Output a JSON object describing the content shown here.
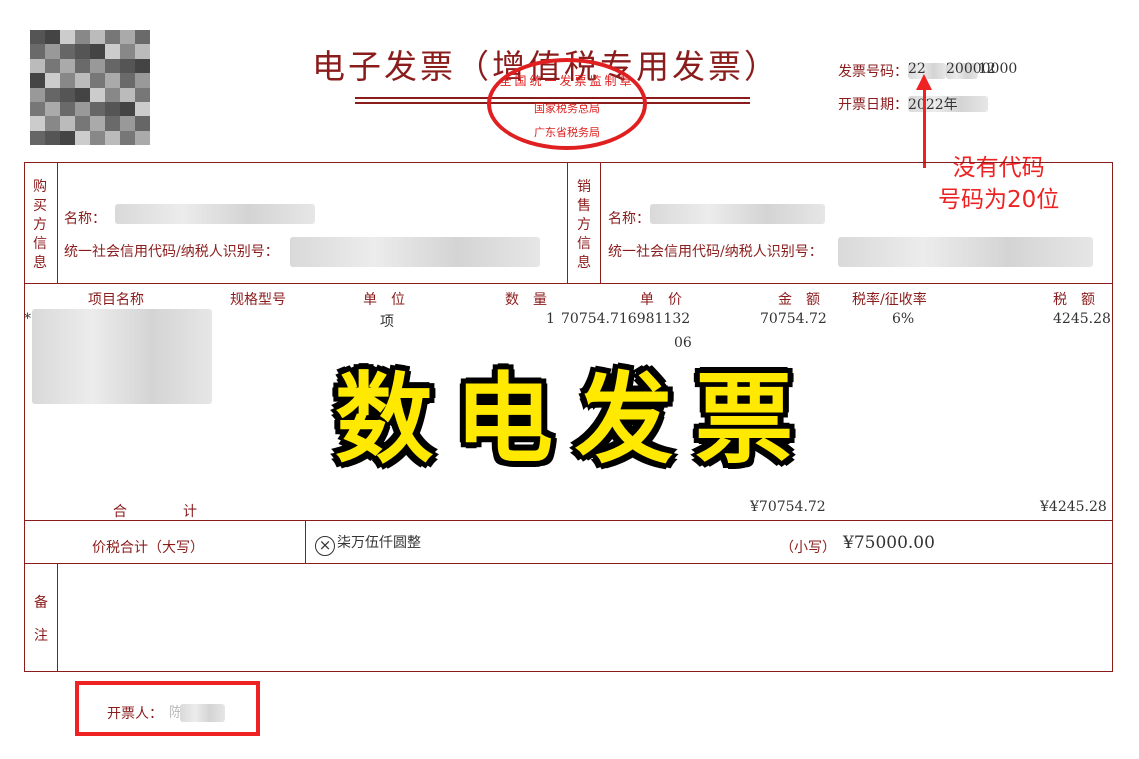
{
  "header": {
    "title": "电子发票（增值税专用发票）",
    "invoice_number_label": "发票号码：",
    "invoice_number_value": "22",
    "invoice_number_suffix": "20000000",
    "invoice_number_end": "12",
    "issue_date_label": "开票日期：",
    "issue_date_value": "2022年"
  },
  "seal": {
    "top": "全国统一发票监制章",
    "middle": "国家税务总局",
    "bottom": "广东省税务局"
  },
  "annotation": {
    "line1": "没有代码",
    "line2": "号码为20位"
  },
  "buyer": {
    "side_label": [
      "购",
      "买",
      "方",
      "信",
      "息"
    ],
    "name_label": "名称：",
    "tax_id_label": "统一社会信用代码/纳税人识别号："
  },
  "seller": {
    "side_label": [
      "销",
      "售",
      "方",
      "信",
      "息"
    ],
    "name_label": "名称：",
    "tax_id_label": "统一社会信用代码/纳税人识别号："
  },
  "items_table": {
    "headers": {
      "item_name": "项目名称",
      "spec": "规格型号",
      "unit": "单　位",
      "quantity": "数　量",
      "unit_price": "单　价",
      "amount": "金　额",
      "tax_rate": "税率/征收率",
      "tax": "税　额"
    },
    "row": {
      "name_prefix": "*",
      "unit": "项",
      "quantity": "1",
      "unit_price": "70754.716981132",
      "unit_price_overflow": "06",
      "amount": "70754.72",
      "tax_rate": "6%",
      "tax": "4245.28"
    },
    "total_label": "合　　　　计",
    "total_amount": "¥70754.72",
    "total_tax": "¥4245.28"
  },
  "grand_total": {
    "label": "价税合计（大写）",
    "chinese_amount": "柒万伍仟圆整",
    "small_label": "（小写）",
    "small_amount": "¥75000.00"
  },
  "remarks": {
    "label_1": "备",
    "label_2": "注"
  },
  "issuer": {
    "label": "开票人：",
    "value": "陈"
  },
  "overlay": {
    "text": "数电发票"
  },
  "colors": {
    "form_border": "#8b1c1c",
    "seal_red": "#e02020",
    "annotation_red": "#ee2222",
    "overlay_yellow": "#ffe900"
  }
}
